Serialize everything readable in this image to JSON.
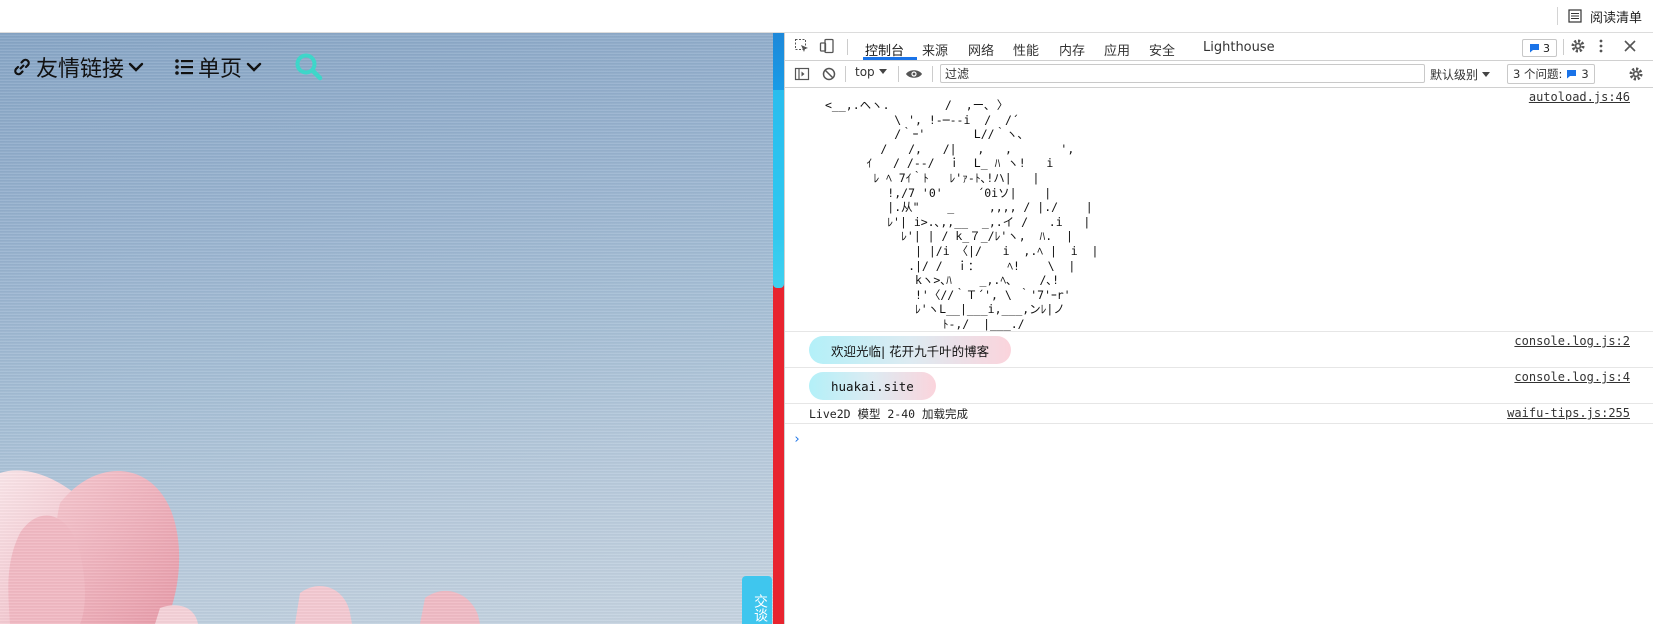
{
  "browser": {
    "reading_list_label": "阅读清单"
  },
  "page": {
    "nav": [
      {
        "label": "友情链接"
      },
      {
        "label": "单页"
      }
    ],
    "chat_tab_label": "交谈"
  },
  "devtools": {
    "tabs": [
      "控制台",
      "来源",
      "网络",
      "性能",
      "内存",
      "应用",
      "安全",
      "Lighthouse"
    ],
    "active_tab": "控制台",
    "issues_count": "3",
    "toolbar": {
      "context": "top",
      "filter_placeholder": "过滤",
      "levels_label": "默认级别",
      "issues_label": "3 个问题:",
      "issues_count": "3"
    },
    "console": {
      "ascii_source": "autoload.js:46",
      "ascii_art": "<__,.ヘヽ.        /  ,ー､ 〉\n          \\ ', !-─‐-i  /  /´\n          /｀ｰ'       L//｀ヽ､\n        /   /,   /|   ,   ,       ',\n      ｲ   / /-‐/  ｉ  L_ ﾊ ヽ!   i\n       ﾚ ﾍ 7ｲ｀ﾄ   ﾚ'ｧ-ﾄ､!ハ|   |\n         !,/7 '0'     ´0iソ|    |\n         |.从\"    _     ,,,, / |./    |\n         ﾚ'| i>.､,,__  _,.イ /   .i   |\n           ﾚ'| | / k_７_/ﾚ'ヽ,  ﾊ.  |\n             | |/i 〈|/   i  ,.ﾍ |  i  |\n            .|/ /  ｉ：    ﾍ!    \\  |\n             kヽ>､ﾊ    _,.ﾍ､    /､!\n             !'〈//｀Ｔ´', \\ ｀'7'ｰr'\n             ﾚ'ヽL__|___i,___,ンﾚ|ノ\n                 ﾄ-,/  |___./\n                 'ｰ'    !_,.:",
      "messages": [
        {
          "text": "欢迎光临| 花开九千叶的博客",
          "source": "console.log.js:2"
        },
        {
          "text": "huakai.site",
          "source": "console.log.js:4"
        },
        {
          "text": "Live2D 模型 2-40 加载完成",
          "source": "waifu-tips.js:255"
        }
      ],
      "prompt": "›"
    }
  },
  "colors": {
    "accent": "#1a73e8",
    "search_icon": "#3ed6c9",
    "scrollbar_red": "#e8242f",
    "scrollbar_blue": "#16a6ee"
  }
}
